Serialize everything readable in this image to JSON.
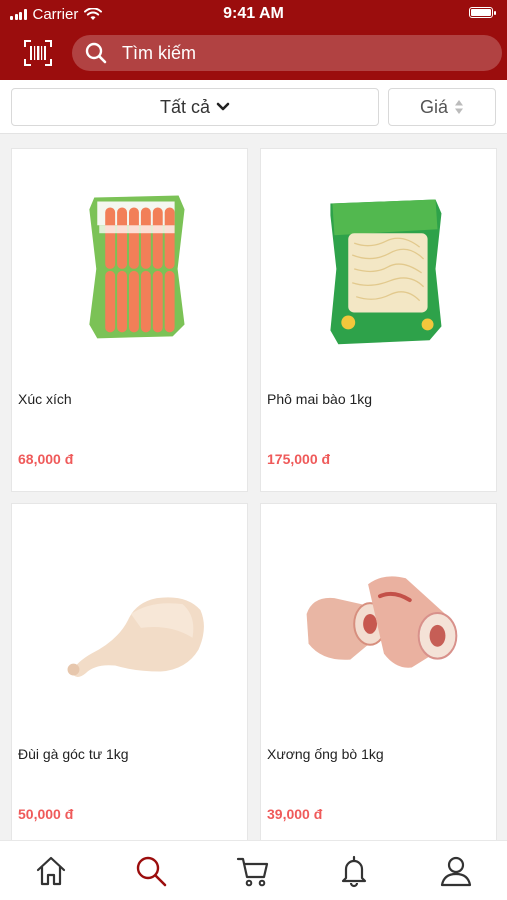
{
  "status_bar": {
    "carrier": "Carrier",
    "time": "9:41 AM"
  },
  "header": {
    "search_placeholder": "Tìm kiếm"
  },
  "filters": {
    "category_label": "Tất cả",
    "price_label": "Giá"
  },
  "products": [
    {
      "name": "Xúc xích",
      "price": "68,000 đ"
    },
    {
      "name": "Phô mai bào 1kg",
      "price": "175,000 đ"
    },
    {
      "name": "Đùi gà góc tư 1kg",
      "price": "50,000 đ"
    },
    {
      "name": "Xương ống bò 1kg",
      "price": "39,000 đ"
    }
  ],
  "bottom_nav": [
    "home-icon",
    "search-icon",
    "cart-icon",
    "bell-icon",
    "user-icon"
  ],
  "colors": {
    "brand": "#9b0d0d",
    "price": "#ef5a5a",
    "nav_active": "#9b0d0d",
    "nav_inactive": "#333333"
  }
}
